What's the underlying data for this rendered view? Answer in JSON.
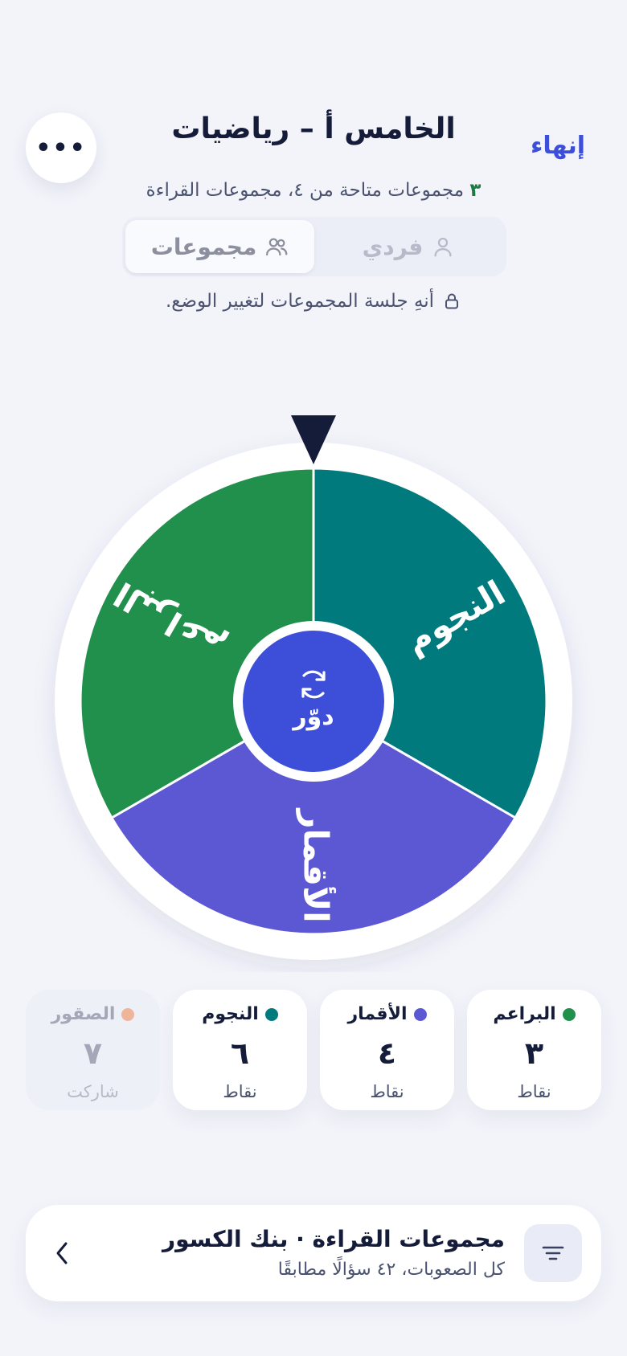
{
  "header": {
    "title": "الخامس أ – رياضيات",
    "end_label": "إنهاء",
    "more_glyph": "•••",
    "subtitle_count": "٣",
    "subtitle_rest": "مجموعات متاحة من ٤، مجموعات القراءة"
  },
  "mode_toggle": {
    "options": [
      {
        "label": "مجموعات",
        "icon": "users-icon",
        "active": true
      },
      {
        "label": "فردي",
        "icon": "user-icon",
        "active": false
      }
    ]
  },
  "lock_note": {
    "text": "أنهِ جلسة المجموعات لتغيير الوضع.",
    "icon": "lock-icon"
  },
  "wheel": {
    "spin_label": "دوّر",
    "spin_icon": "refresh-icon",
    "pointer_icon": "pointer-triangle-icon",
    "segments": [
      {
        "label": "النجوم",
        "color": "#017a7d"
      },
      {
        "label": "الأقمار",
        "color": "#5c58d4"
      },
      {
        "label": "البراعم",
        "color": "#22904d"
      }
    ]
  },
  "scores": [
    {
      "name": "البراعم",
      "value": "٣",
      "unit": "نقاط",
      "color": "#22904d",
      "muted": false
    },
    {
      "name": "الأقمار",
      "value": "٤",
      "unit": "نقاط",
      "color": "#5c58d4",
      "muted": false
    },
    {
      "name": "النجوم",
      "value": "٦",
      "unit": "نقاط",
      "color": "#017a7d",
      "muted": false
    },
    {
      "name": "الصقور",
      "value": "٧",
      "unit": "شاركت",
      "color": "#efb59a",
      "muted": true
    }
  ],
  "question_bank": {
    "title": "مجموعات القراءة · بنك الكسور",
    "subtitle": "كل الصعوبات، ٤٢ سؤالًا مطابقًا",
    "icon": "filter-icon",
    "chevron_icon": "chevron-left-icon"
  },
  "colors": {
    "accent": "#3d4fd9",
    "hub": "#3d4fd9",
    "pointer": "#141c3a"
  }
}
